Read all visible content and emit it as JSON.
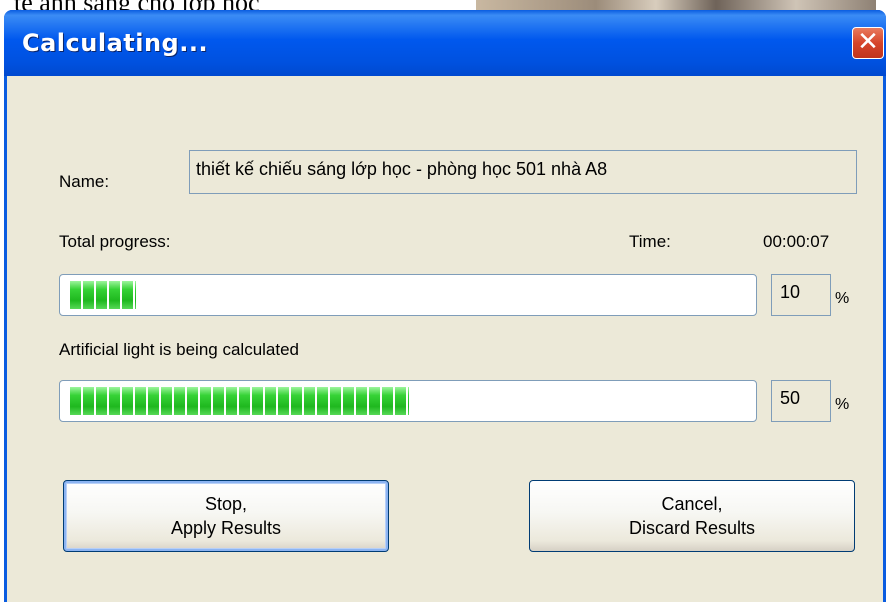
{
  "background": {
    "doc_text": "tế ánh sáng cho lớp học"
  },
  "window": {
    "title": "Calculating...",
    "close_glyph": "✕"
  },
  "form": {
    "name_label": "Name:",
    "name_value": "thiết  kế chiếu sáng lớp học  - phòng học 501 nhà A8",
    "total_progress_label": "Total progress:",
    "time_label": "Time:",
    "time_value": "00:00:07",
    "total_percent": "10",
    "total_percent_fraction": 0.1,
    "percent_sign": "%",
    "stage_label": "Artificial light is being calculated",
    "stage_percent": "50",
    "stage_percent_fraction": 0.5
  },
  "buttons": {
    "stop_line1": "Stop,",
    "stop_line2": "Apply Results",
    "cancel_line1": "Cancel,",
    "cancel_line2": "Discard Results"
  },
  "colors": {
    "titlebar": "#0058ee",
    "client_bg": "#ece9d8",
    "progress_green": "#2cd52c",
    "close_red": "#d6452a"
  }
}
